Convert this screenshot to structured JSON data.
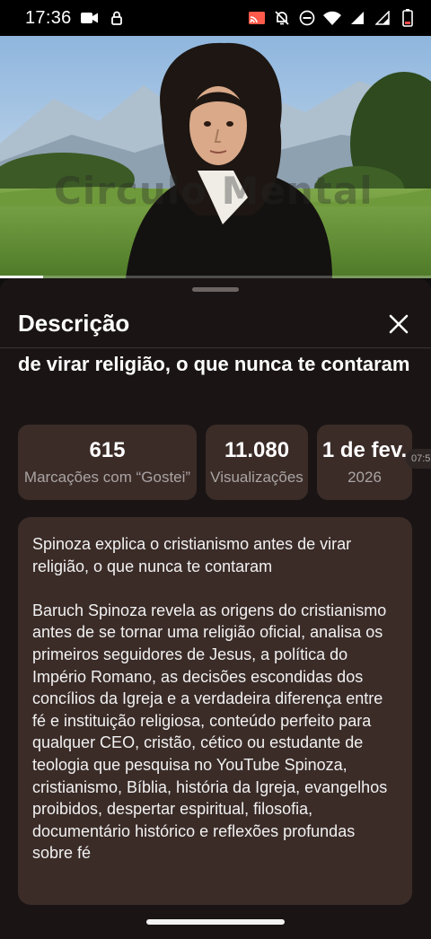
{
  "status_bar": {
    "time": "17:36"
  },
  "video": {
    "watermark": "Circulo Mental",
    "progress": 0.1
  },
  "sheet": {
    "title": "Descrição",
    "video_title": "de virar religião, o que nunca te contaram",
    "stats": {
      "likes_value": "615",
      "likes_label": "Marcações com “Gostei”",
      "views_value": "11.080",
      "views_label": "Visualizações",
      "date_value": "1 de fev.",
      "date_label": "2026"
    },
    "timestamp_chip": "07:5",
    "description": {
      "paragraph_1": "Spinoza explica o cristianismo antes de virar religião, o que nunca te contaram",
      "paragraph_2": "Baruch Spinoza revela as origens do cristianismo antes de se tornar uma religião oficial, analisa os primeiros seguidores de Jesus, a política do Império Romano, as decisões escondidas dos concílios da Igreja e a verdadeira diferença entre fé e instituição religiosa, conteúdo perfeito para qualquer CEO, cristão, cético ou estudante de teologia que pesquisa no YouTube Spinoza, cristianismo, Bíblia, história da Igreja, evangelhos proibidos, despertar espiritual, filosofia, documentário histórico e reflexões profundas sobre fé"
    }
  }
}
